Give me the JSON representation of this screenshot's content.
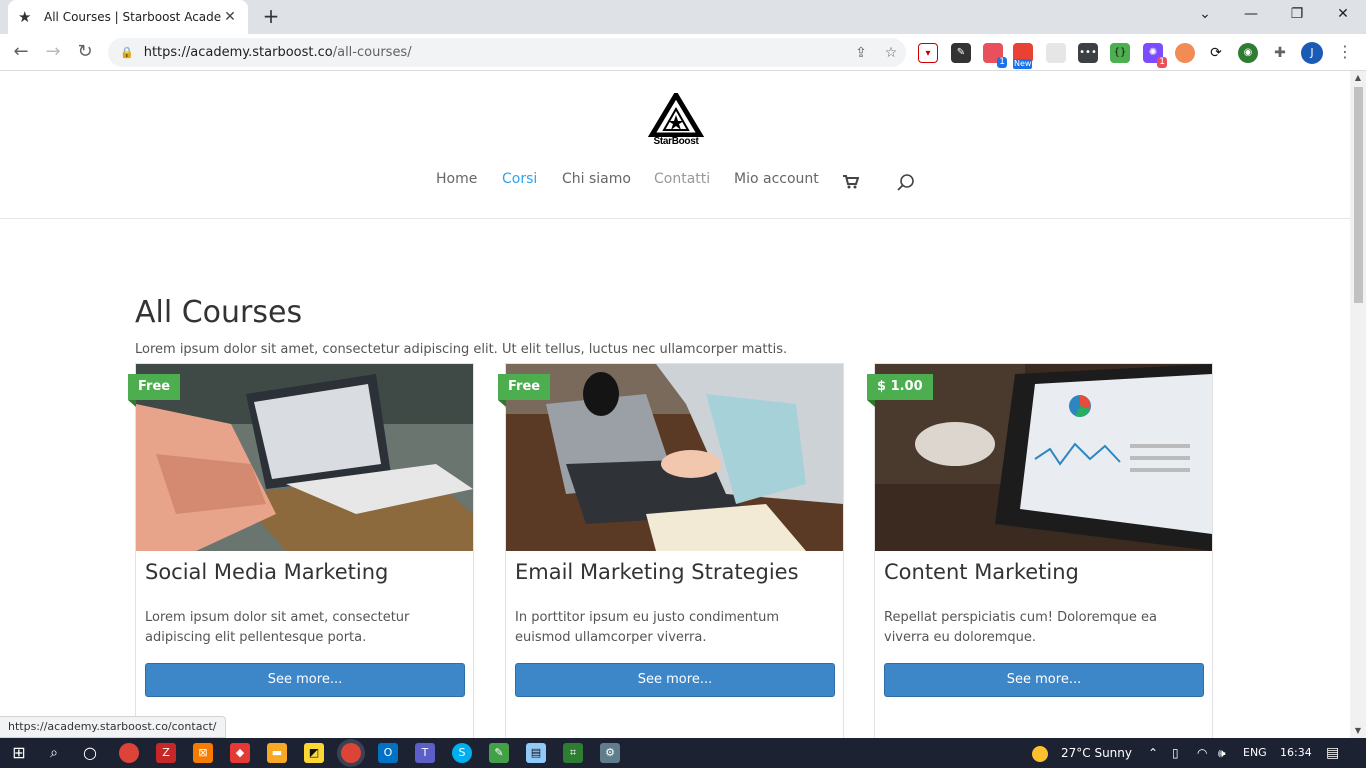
{
  "browser": {
    "tab_title": "All Courses | Starboost Academy",
    "url_main": "https://academy.starboost.co",
    "url_path": "/all-courses/",
    "new_tab_symbol": "+",
    "profile_initial": "J",
    "ext_badges": {
      "badge1": "1",
      "badge2": "New",
      "badge3": "1"
    }
  },
  "site": {
    "logo_text": "StarBoost",
    "nav": [
      {
        "label": "Home",
        "state": "normal"
      },
      {
        "label": "Corsi",
        "state": "active"
      },
      {
        "label": "Chi siamo",
        "state": "normal"
      },
      {
        "label": "Contatti",
        "state": "hover"
      },
      {
        "label": "Mio account",
        "state": "normal"
      }
    ]
  },
  "page": {
    "title": "All Courses",
    "lead": "Lorem ipsum dolor sit amet, consectetur adipiscing elit. Ut elit tellus, luctus nec ullamcorper mattis."
  },
  "courses": [
    {
      "badge": "Free",
      "title": "Social Media Marketing",
      "desc": "Lorem ipsum dolor sit amet, consectetur adipiscing elit pellentesque porta.",
      "button": "See more..."
    },
    {
      "badge": "Free",
      "title": "Email Marketing Strategies",
      "desc": "In porttitor ipsum eu justo condimentum euismod ullamcorper viverra.",
      "button": "See more..."
    },
    {
      "badge": "$ 1.00",
      "title": "Content Marketing",
      "desc": "Repellat perspiciatis cum! Doloremque ea viverra eu doloremque.",
      "button": "See more..."
    }
  ],
  "status_bar": "https://academy.starboost.co/contact/",
  "taskbar": {
    "weather": "27°C  Sunny",
    "lang": "ENG",
    "time": "16:34"
  },
  "colors": {
    "accent": "#2ea3f2",
    "badge": "#4cae4f",
    "button": "#3d87c9"
  }
}
